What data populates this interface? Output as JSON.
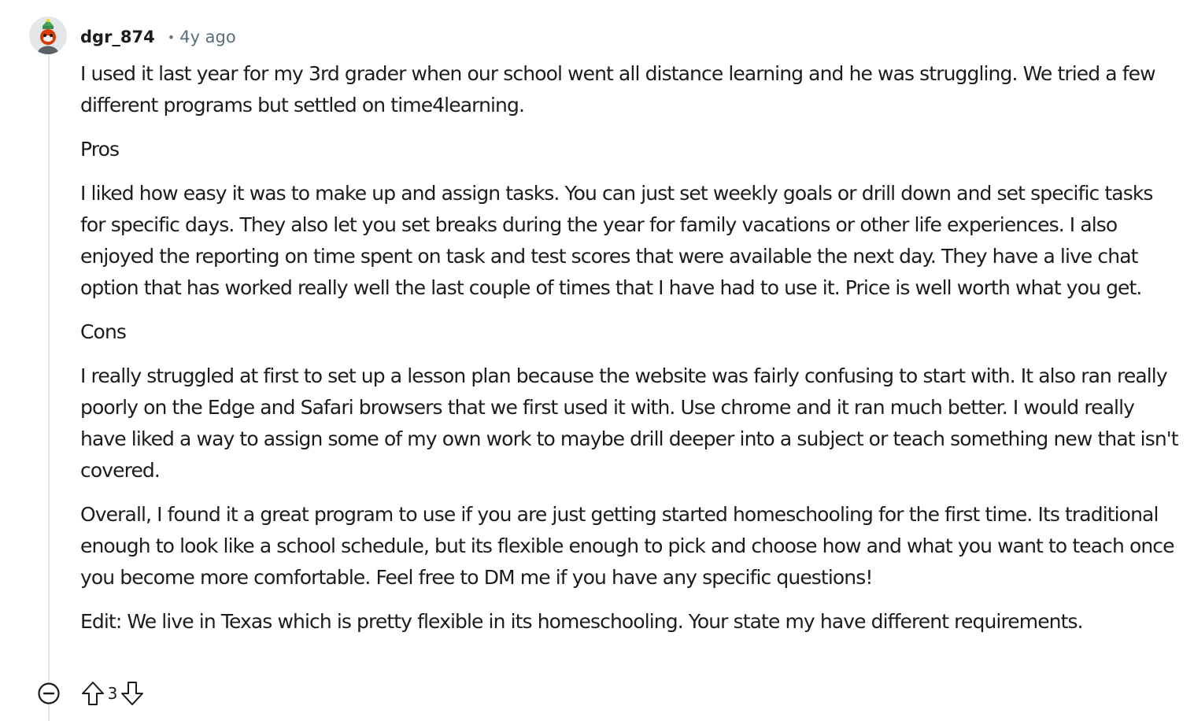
{
  "comment": {
    "author": "dgr_874",
    "separator": "•",
    "age": "4y ago",
    "paragraphs": [
      "I used it last year for my 3rd grader when our school went all distance learning and he was struggling. We tried a few different programs but settled on time4learning.",
      "Pros",
      "I liked how easy it was to make up and assign tasks. You can just set weekly goals or drill down and set specific tasks for specific days. They also let you set breaks during the year for family vacations or other life experiences. I also enjoyed the reporting on time spent on task and test scores that were available the next day. They have a live chat option that has worked really well the last couple of times that I have had to use it. Price is well worth what you get.",
      "Cons",
      "I really struggled at first to set up a lesson plan because the website was fairly confusing to start with. It also ran really poorly on the Edge and Safari browsers that we first used it with. Use chrome and it ran much better. I would really have liked a way to assign some of my own work to maybe drill deeper into a subject or teach something new that isn't covered.",
      "Overall, I found it a great program to use if you are just getting started homeschooling for the first time. Its traditional enough to look like a school schedule, but its flexible enough to pick and choose how and what you want to teach once you become more comfortable. Feel free to DM me if you have any specific questions!",
      "Edit: We live in Texas which is pretty flexible in its homeschooling. Your state my have different requirements."
    ],
    "score": "3"
  },
  "icons": {
    "avatar": "avatar-icon",
    "collapse": "collapse-minus-icon",
    "upvote": "upvote-arrow-icon",
    "downvote": "downvote-arrow-icon"
  },
  "colors": {
    "text": "#1c1c1c",
    "meta": "#576f76",
    "thread_line": "#e5e7e9",
    "avatar_accent": "#d93a00"
  }
}
